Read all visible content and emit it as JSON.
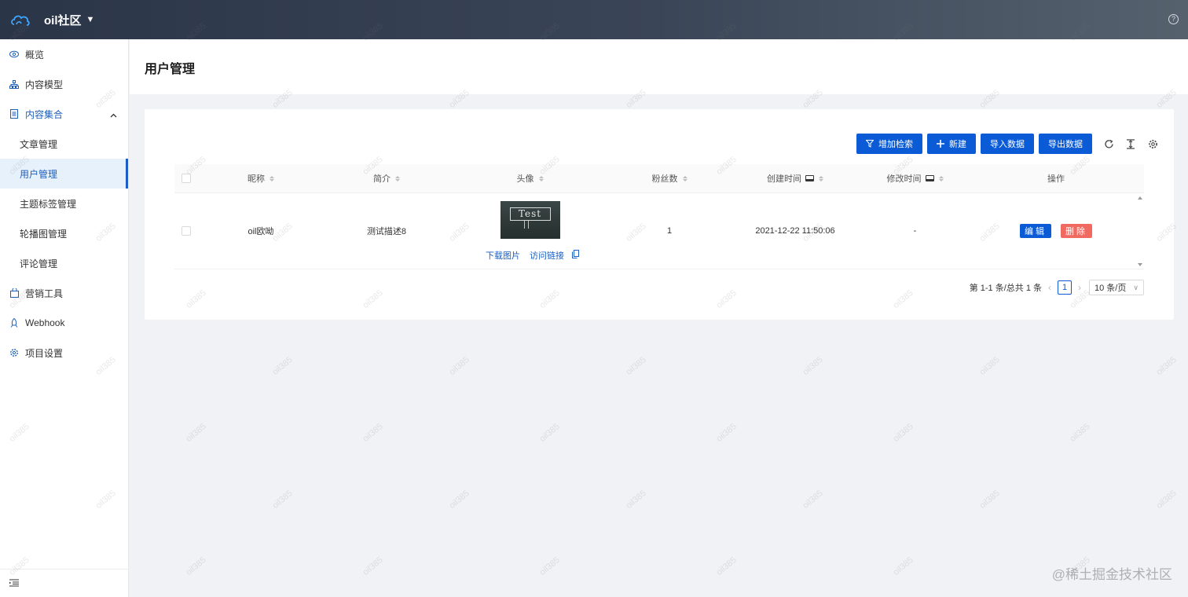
{
  "header": {
    "brand": "oil社区"
  },
  "sidebar": {
    "items": [
      {
        "label": "概览",
        "icon": "eye-icon"
      },
      {
        "label": "内容模型",
        "icon": "sitemap-icon"
      },
      {
        "label": "内容集合",
        "icon": "document-icon",
        "expanded": true,
        "children": [
          "文章管理",
          "用户管理",
          "主题标签管理",
          "轮播图管理",
          "评论管理"
        ],
        "active_child": "用户管理"
      },
      {
        "label": "营销工具",
        "icon": "shopping-bag-icon"
      },
      {
        "label": "Webhook",
        "icon": "rocket-icon"
      },
      {
        "label": "项目设置",
        "icon": "gear-icon"
      }
    ]
  },
  "page": {
    "title": "用户管理"
  },
  "toolbar": {
    "search_label": "增加检索",
    "new_label": "新建",
    "import_label": "导入数据",
    "export_label": "导出数据"
  },
  "table": {
    "columns": [
      "昵称",
      "简介",
      "头像",
      "粉丝数",
      "创建时间",
      "修改时间",
      "操作"
    ],
    "rows": [
      {
        "nickname": "oil欧呦",
        "intro": "测试描述8",
        "avatar_text": "Test",
        "avatar_download": "下载图片",
        "avatar_visit": "访问链接",
        "fans": "1",
        "created": "2021-12-22 11:50:06",
        "modified": "-",
        "edit": "编辑",
        "delete": "删除"
      }
    ]
  },
  "pagination": {
    "summary": "第 1-1 条/总共 1 条",
    "current": "1",
    "page_size": "10 条/页"
  },
  "watermark": "oil385",
  "footer_credit": "@稀土掘金技术社区",
  "colors": {
    "primary": "#0b5bd6",
    "danger": "#f16a62",
    "header_dark": "#2b3548"
  }
}
